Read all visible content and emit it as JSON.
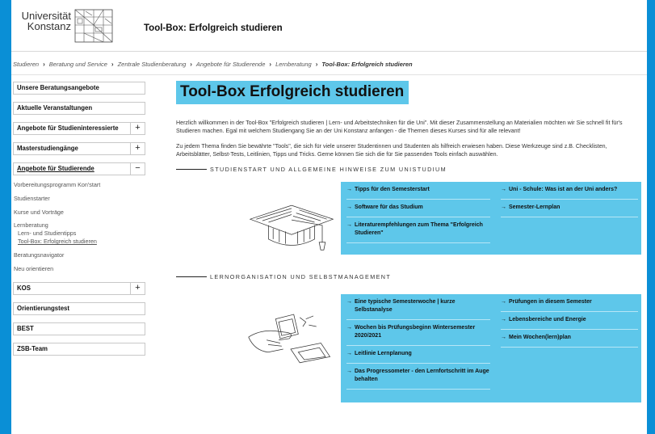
{
  "header": {
    "logo_line1": "Universität",
    "logo_line2": "Konstanz",
    "site_title": "Tool-Box: Erfolgreich studieren"
  },
  "breadcrumb": [
    "Studieren",
    "Beratung und Service",
    "Zentrale Studienberatung",
    "Angebote für Studierende",
    "Lernberatung",
    "Tool-Box: Erfolgreich studieren"
  ],
  "sidebar": {
    "box1": "Unsere Beratungsangebote",
    "box2": "Aktuelle Veranstaltungen",
    "box3": "Angebote für Studieninteressierte",
    "box4": "Masterstudiengänge",
    "box5": "Angebote für Studierende",
    "sub1": "Vorbereitungsprogramm Kon'start",
    "sub2": "Studienstarter",
    "sub3": "Kurse und Vorträge",
    "sub4": "Lernberatung",
    "sub4a": "Lern- und Studientipps",
    "sub4b": "Tool-Box: Erfolgreich studieren",
    "sub5": "Beratungsnavigator",
    "sub6": "Neu orientieren",
    "box6": "KOS",
    "box7": "Orientierungstest",
    "box8": "BEST",
    "box9": "ZSB-Team",
    "plus": "+",
    "minus": "−"
  },
  "main": {
    "title": "Tool-Box Erfolgreich studieren",
    "intro1": "Herzlich willkommen in der Tool-Box \"Erfolgreich studieren | Lern- und Arbeitstechniken für die Uni\". Mit dieser Zusammenstellung an Materialien möchten wir Sie schnell fit für's Studieren machen. Egal mit welchem Studiengang Sie an der Uni Konstanz anfangen - die Themen dieses Kurses sind für alle relevant!",
    "intro2": "Zu jedem Thema finden Sie bewährte \"Tools\", die sich für viele unserer Studentinnen und Studenten als hilfreich erwiesen haben. Diese Werkzeuge sind z.B. Checklisten, Arbeitsblätter, Selbst-Tests, Leitlinien, Tipps und Tricks. Gerne können Sie sich die für Sie passenden Tools einfach auswählen.",
    "section1": {
      "heading": "STUDIENSTART UND ALLGEMEINE HINWEISE ZUM UNISTUDIUM",
      "left": [
        "Tipps für den Semesterstart",
        "Software für das Studium",
        "Literaturempfehlungen zum Thema \"Erfolgreich Studieren\""
      ],
      "right": [
        "Uni - Schule: Was ist an der Uni anders?",
        "Semester-Lernplan"
      ]
    },
    "section2": {
      "heading": "LERNORGANISATION UND SELBSTMANAGEMENT",
      "left": [
        "Eine typische Semesterwoche | kurze Selbstanalyse",
        "Wochen bis Prüfungsbeginn Wintersemester 2020/2021",
        "Leitlinie Lernplanung",
        "Das Progressometer - den Lernfortschritt im Auge behalten"
      ],
      "right": [
        "Prüfungen in diesem Semester",
        "Lebensbereiche und Energie",
        "Mein Wochen(lern)plan"
      ]
    },
    "arrow": "→"
  },
  "colors": {
    "accent": "#5ec7ea",
    "frame": "#0a8fd6"
  }
}
